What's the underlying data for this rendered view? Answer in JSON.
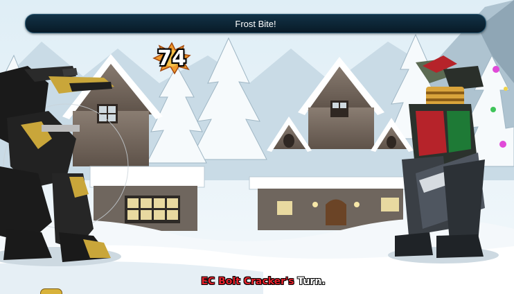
{
  "battle": {
    "message": "Frost Bite!",
    "damage_number": "74",
    "turn": {
      "name": "EC Bolt Cracker's",
      "suffix": " Turn."
    }
  },
  "colors": {
    "banner_bg": "#0b2232",
    "turn_name": "#e4202a",
    "snow": "#f4f8fb",
    "sky": "#e9f2f8"
  },
  "icons": [
    "player-robot-mech",
    "enemy-robot-mech",
    "damage-burst-icon",
    "cabin",
    "pine-tree",
    "mountain"
  ]
}
